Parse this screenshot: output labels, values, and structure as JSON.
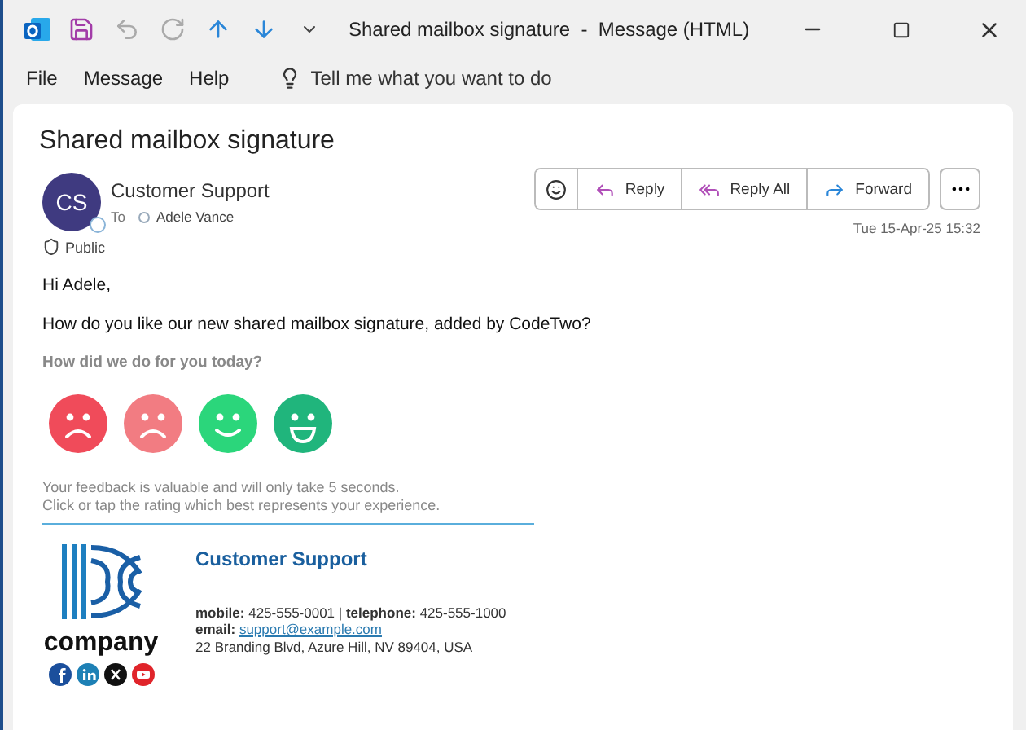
{
  "window": {
    "title": "Shared mailbox signature  -  Message (HTML)"
  },
  "menu": [
    {
      "label": "File"
    },
    {
      "label": "Message"
    },
    {
      "label": "Help"
    }
  ],
  "tell_me": {
    "placeholder": "Tell me what you want to do"
  },
  "message": {
    "subject": "Shared mailbox signature",
    "sender_initials": "CS",
    "sender": "Customer Support",
    "to_label": "To",
    "recipient": "Adele Vance",
    "sensitivity": "Public",
    "actions": [
      {
        "label": "Reply",
        "kind": "reply"
      },
      {
        "label": "Reply All",
        "kind": "reply-all"
      },
      {
        "label": "Forward",
        "kind": "forward"
      }
    ],
    "date": "Tue 15-Apr-25 15:32"
  },
  "body": {
    "greeting": "Hi Adele,",
    "text": "How do you like our new shared mailbox signature, added by CodeTwo?",
    "question": "How did we do for you today?",
    "ratings": [
      {
        "kind": "sad",
        "color": "#f04b5a"
      },
      {
        "kind": "sad",
        "color": "#f27c82"
      },
      {
        "kind": "smile",
        "color": "#2bd67b"
      },
      {
        "kind": "grin",
        "color": "#20b57c"
      }
    ],
    "note": [
      "Your feedback is valuable and will only take 5 seconds.",
      "Click or tap the rating which best represents your experience."
    ]
  },
  "signature": {
    "logo_text": "company",
    "name": "Customer Support",
    "phones": "**mobile:** 425-555-0001  |  **telephone:** 425-555-1000",
    "email_label": "email:",
    "email": "support@example.com",
    "address": "22 Branding Blvd, Azure Hill, NV 89404, USA",
    "social": [
      {
        "kind": "facebook"
      },
      {
        "kind": "linkedin"
      },
      {
        "kind": "x"
      },
      {
        "kind": "youtube"
      }
    ]
  }
}
